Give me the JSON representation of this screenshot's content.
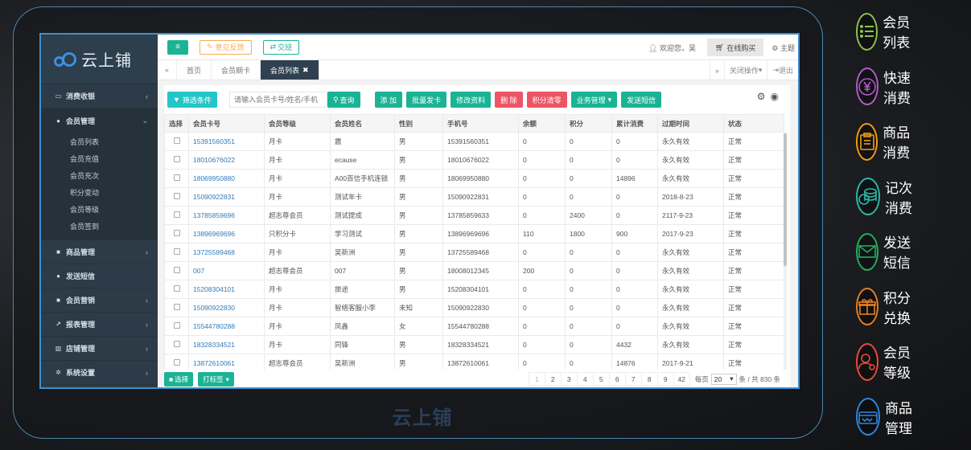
{
  "app": {
    "logo": "云上铺",
    "watermark": "云上铺"
  },
  "sidebar": {
    "items": [
      {
        "label": "消费收银",
        "icon": "card-icon",
        "glyph": "▭"
      },
      {
        "label": "会员管理",
        "icon": "user-icon",
        "glyph": "●",
        "open": true
      },
      {
        "label": "商品管理",
        "icon": "box-icon",
        "glyph": "■"
      },
      {
        "label": "发送短信",
        "icon": "chat-icon",
        "glyph": "●"
      },
      {
        "label": "会员营销",
        "icon": "briefcase-icon",
        "glyph": "■"
      },
      {
        "label": "报表管理",
        "icon": "chart-icon",
        "glyph": "↗"
      },
      {
        "label": "店铺管理",
        "icon": "bank-icon",
        "glyph": "▥"
      },
      {
        "label": "系统设置",
        "icon": "gears-icon",
        "glyph": "✲"
      }
    ],
    "sub_items": [
      "会员列表",
      "会员充值",
      "会员充次",
      "积分变动",
      "会员等级",
      "会员签到"
    ]
  },
  "topbar": {
    "feedback": "意见反馈",
    "shift": "交班",
    "welcome": "欢迎您，吴",
    "buy": "在线购买",
    "theme": "主题"
  },
  "tabs": {
    "items": [
      "首页",
      "会员期卡",
      "会员列表"
    ],
    "close_ops": "关闭操作",
    "logout": "退出"
  },
  "toolbar": {
    "filter": "筛选条件",
    "search_placeholder": "请输入会员卡号/姓名/手机",
    "search": "查询",
    "add": "添 加",
    "batch_card": "批量发卡",
    "edit": "修改资料",
    "delete": "删 除",
    "clear_points": "积分清零",
    "business": "业务管理",
    "send_sms": "发送短信"
  },
  "table": {
    "headers": [
      "选择",
      "会员卡号",
      "会员等级",
      "会员姓名",
      "性别",
      "手机号",
      "余额",
      "积分",
      "累计消费",
      "过期时间",
      "状态"
    ],
    "rows": [
      [
        "15391560351",
        "月卡",
        "震",
        "男",
        "15391560351",
        "0",
        "0",
        "0",
        "永久有效",
        "正常"
      ],
      [
        "18010676022",
        "月卡",
        "ecause",
        "男",
        "18010676022",
        "0",
        "0",
        "0",
        "永久有效",
        "正常"
      ],
      [
        "18069950880",
        "月卡",
        "A00百信手机连锁",
        "男",
        "18069950880",
        "0",
        "0",
        "14896",
        "永久有效",
        "正常"
      ],
      [
        "15090922831",
        "月卡",
        "测试年卡",
        "男",
        "15090922831",
        "0",
        "0",
        "0",
        "2018-8-23",
        "正常"
      ],
      [
        "13785859696",
        "超志尊会员",
        "测试提成",
        "男",
        "13785859633",
        "0",
        "2400",
        "0",
        "2117-9-23",
        "正常"
      ],
      [
        "13896969696",
        "只积分卡",
        "学习测试",
        "男",
        "13896969696",
        "110",
        "1800",
        "900",
        "2017-9-23",
        "正常"
      ],
      [
        "13725589468",
        "月卡",
        "吴新洲",
        "男",
        "13725589468",
        "0",
        "0",
        "0",
        "永久有效",
        "正常"
      ],
      [
        "007",
        "超志尊会员",
        "007",
        "男",
        "18008012345",
        "200",
        "0",
        "0",
        "永久有效",
        "正常"
      ],
      [
        "15208304101",
        "月卡",
        "旅途",
        "男",
        "15208304101",
        "0",
        "0",
        "0",
        "永久有效",
        "正常"
      ],
      [
        "15090922830",
        "月卡",
        "智络客服小李",
        "未知",
        "15090922830",
        "0",
        "0",
        "0",
        "永久有效",
        "正常"
      ],
      [
        "15544780288",
        "月卡",
        "凤鑫",
        "女",
        "15544780288",
        "0",
        "0",
        "0",
        "永久有效",
        "正常"
      ],
      [
        "18328334521",
        "月卡",
        "同锋",
        "男",
        "18328334521",
        "0",
        "0",
        "4432",
        "永久有效",
        "正常"
      ],
      [
        "13872610061",
        "超志尊会员",
        "吴新洲",
        "男",
        "13872610061",
        "0",
        "0",
        "14876",
        "2017-9-21",
        "正常"
      ]
    ]
  },
  "footer": {
    "select": "选择",
    "tag": "打标签",
    "pages": [
      "1",
      "2",
      "3",
      "4",
      "5",
      "6",
      "7",
      "8",
      "9",
      "42"
    ],
    "per_page_label": "每页",
    "per_page_value": "20",
    "total": "条 / 共 830 条"
  },
  "features": [
    {
      "label": "会员列表",
      "color": "#8bc34a",
      "icon": "list-icon"
    },
    {
      "label": "快速消费",
      "color": "#b05cc6",
      "icon": "yen-icon"
    },
    {
      "label": "商品消费",
      "color": "#f39c12",
      "icon": "clipboard-icon"
    },
    {
      "label": "记次消费",
      "color": "#2bb8a8",
      "icon": "coins-icon"
    },
    {
      "label": "发送短信",
      "color": "#27ae60",
      "icon": "mail-icon"
    },
    {
      "label": "积分兑换",
      "color": "#e67e22",
      "icon": "gift-icon"
    },
    {
      "label": "会员等级",
      "color": "#e74c3c",
      "icon": "member-level-icon"
    },
    {
      "label": "商品管理",
      "color": "#2e86de",
      "icon": "wallet-icon"
    }
  ]
}
